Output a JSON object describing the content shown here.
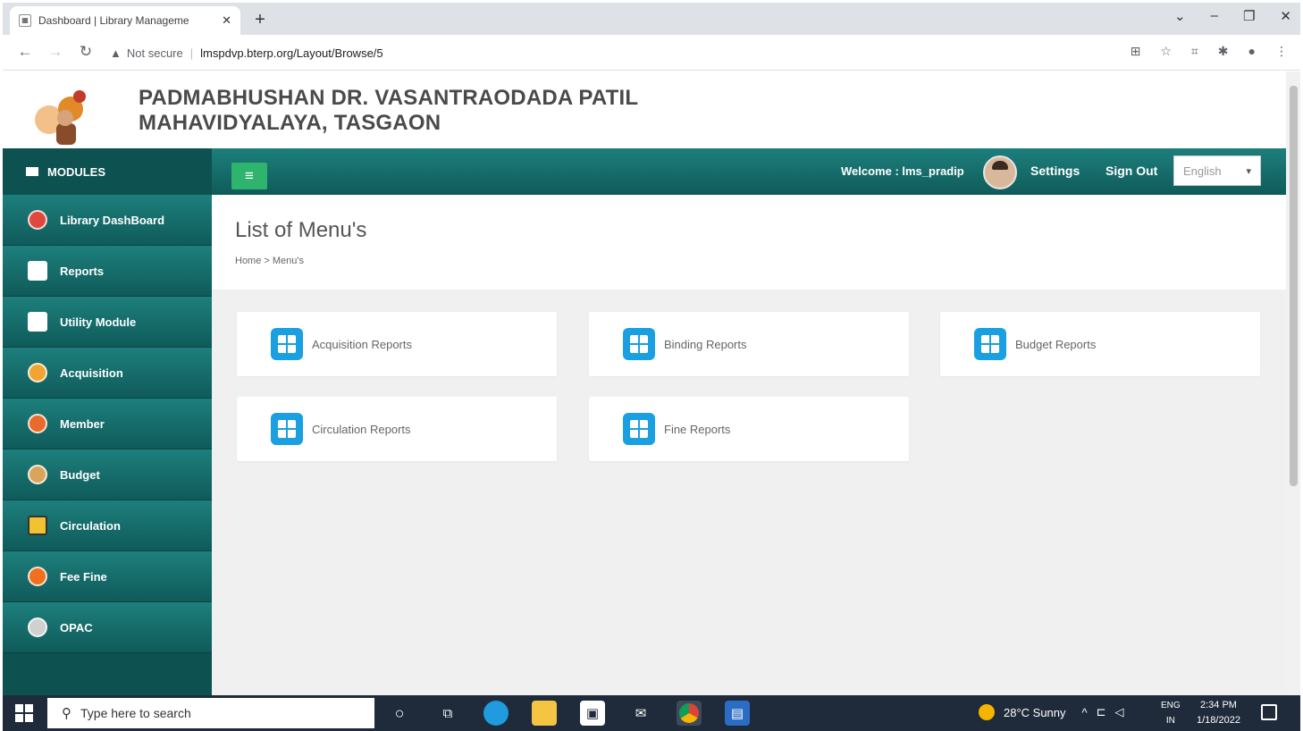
{
  "browser": {
    "tab_title": "Dashboard | Library Manageme",
    "tab_close": "✕",
    "new_tab": "+",
    "omnibox_warning": "Not secure",
    "url": "lmspdvp.bterp.org/Layout/Browse/5"
  },
  "header": {
    "college_line1": "PADMABHUSHAN DR. VASANTRAODADA PATIL",
    "college_line2": "MAHAVIDYALAYA, TASGAON"
  },
  "topbar": {
    "modules_label": "MODULES",
    "welcome_text": "Welcome : lms_pradip",
    "settings_label": "Settings",
    "signout_label": "Sign Out",
    "language_selected": "English"
  },
  "sidebar": {
    "items": [
      {
        "label": "Library DashBoard",
        "color": "#e0483e"
      },
      {
        "label": "Reports",
        "color": "#ffffff"
      },
      {
        "label": "Utility Module",
        "color": "#ffffff"
      },
      {
        "label": "Acquisition",
        "color": "#f0a531"
      },
      {
        "label": "Member",
        "color": "#e86a2c"
      },
      {
        "label": "Budget",
        "color": "#d9a55a"
      },
      {
        "label": "Circulation",
        "color": "#f1c232"
      },
      {
        "label": "Fee Fine",
        "color": "#f07020"
      },
      {
        "label": "OPAC",
        "color": "#d0d0d0"
      }
    ]
  },
  "main": {
    "title": "List of Menu's",
    "breadcrumb": "Home > Menu's",
    "cards": [
      {
        "label": "Acquisition Reports"
      },
      {
        "label": "Binding Reports"
      },
      {
        "label": "Budget Reports"
      },
      {
        "label": "Circulation Reports"
      },
      {
        "label": "Fine Reports"
      }
    ]
  },
  "taskbar": {
    "search_placeholder": "Type here to search",
    "weather": "28°C  Sunny",
    "lang_line1": "ENG",
    "lang_line2": "IN",
    "time": "2:34 PM",
    "date": "1/18/2022"
  },
  "colors": {
    "teal_bar": "#1d7f7c",
    "teal_dark": "#0d5150",
    "hamburger_green": "#2fb46e",
    "card_icon_blue": "#1a9fe0"
  }
}
